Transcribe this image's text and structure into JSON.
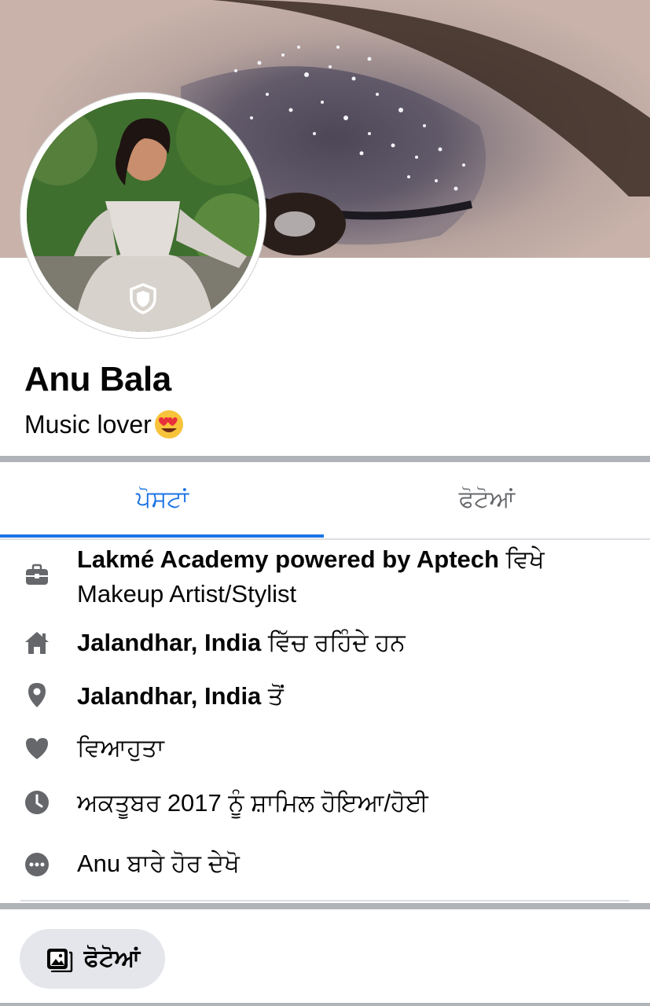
{
  "profile": {
    "name": "Anu Bala",
    "bio": "Music lover",
    "bio_emoji": "heart-eyes-emoji"
  },
  "tabs": [
    {
      "label": "ਪੋਸਟਾਂ",
      "active": true
    },
    {
      "label": "ਫੋਟੋਆਂ",
      "active": false
    }
  ],
  "intro": {
    "work": {
      "bold": "Lakmé Academy powered by Aptech",
      "suffix": " ਵਿਖੇ",
      "line2": "Makeup Artist/Stylist",
      "icon": "briefcase-icon"
    },
    "lives": {
      "bold": "Jalandhar, India",
      "suffix": " ਵਿੱਚ ਰਹਿੰਦੇ ਹਨ",
      "icon": "home-icon"
    },
    "from": {
      "bold": "Jalandhar, India",
      "suffix": " ਤੋਂ",
      "icon": "location-pin-icon"
    },
    "relationship": {
      "text": "ਵਿਆਹੁਤਾ",
      "icon": "heart-icon"
    },
    "joined": {
      "text": "ਅਕਤੂਬਰ 2017 ਨੂੰ ਸ਼ਾਮਿਲ ਹੋਇਆ/ਹੋਈ",
      "icon": "clock-icon"
    },
    "more": {
      "text": "Anu ਬਾਰੇ ਹੋਰ ਦੇਖੋ",
      "icon": "more-dots-icon"
    }
  },
  "photos_button": {
    "label": "ਫੋਟੋਆਂ",
    "icon": "photos-icon"
  },
  "colors": {
    "accent": "#1b74e4",
    "icon_gray": "#65676b",
    "separator": "#b0b3b8",
    "button_bg": "#e4e6eb"
  }
}
